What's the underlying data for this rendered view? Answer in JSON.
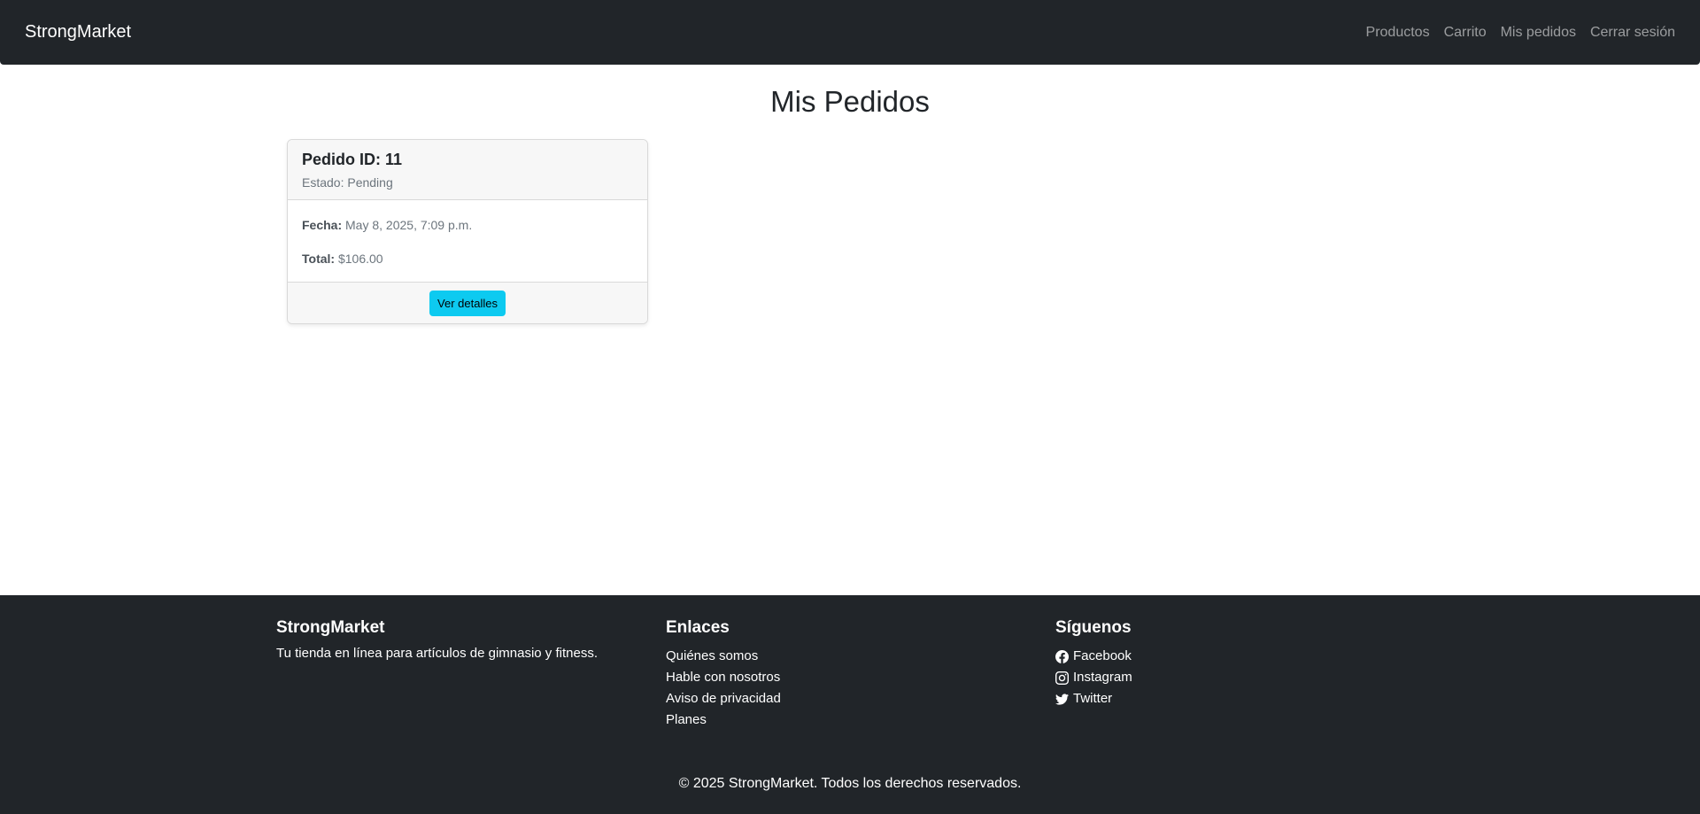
{
  "navbar": {
    "brand": "StrongMarket",
    "links": [
      "Productos",
      "Carrito",
      "Mis pedidos",
      "Cerrar sesión"
    ]
  },
  "main": {
    "title": "Mis Pedidos",
    "orders": [
      {
        "title": "Pedido ID: 11",
        "status": "Estado: Pending",
        "date_label": "Fecha:",
        "date_value": "May 8, 2025, 7:09 p.m.",
        "total_label": "Total:",
        "total_value": "$106.00",
        "button_label": "Ver detalles"
      }
    ]
  },
  "footer": {
    "about": {
      "title": "StrongMarket",
      "text": "Tu tienda en línea para artículos de gimnasio y fitness."
    },
    "links": {
      "title": "Enlaces",
      "items": [
        "Quiénes somos",
        "Hable con nosotros",
        "Aviso de privacidad",
        "Planes"
      ]
    },
    "social": {
      "title": "Síguenos",
      "items": [
        {
          "label": "Facebook",
          "icon": "facebook-icon"
        },
        {
          "label": "Instagram",
          "icon": "instagram-icon"
        },
        {
          "label": "Twitter",
          "icon": "twitter-icon"
        }
      ]
    },
    "copyright": "© 2025 StrongMarket. Todos los derechos reservados."
  },
  "colors": {
    "dark": "#212529",
    "info_button": "#0dcaf0",
    "muted_text": "#6c757d"
  }
}
